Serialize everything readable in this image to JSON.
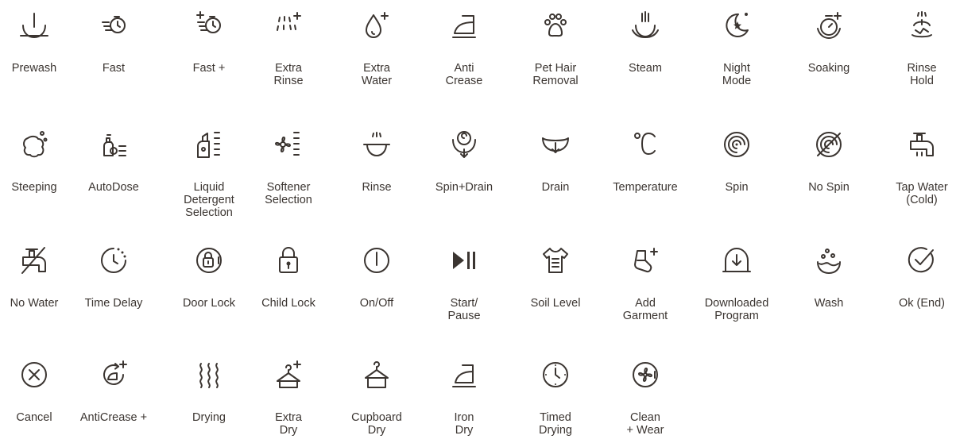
{
  "icons": [
    {
      "label": "Prewash",
      "icon": "prewash-icon"
    },
    {
      "label": "Fast",
      "icon": "fast-icon"
    },
    {
      "label": "Fast +",
      "icon": "fast-plus-icon"
    },
    {
      "label": "Extra\nRinse",
      "icon": "extra-rinse-icon"
    },
    {
      "label": "Extra\nWater",
      "icon": "extra-water-icon"
    },
    {
      "label": "Anti\nCrease",
      "icon": "anti-crease-icon"
    },
    {
      "label": "Pet Hair\nRemoval",
      "icon": "pet-hair-removal-icon"
    },
    {
      "label": "Steam",
      "icon": "steam-icon"
    },
    {
      "label": "Night\nMode",
      "icon": "night-mode-icon"
    },
    {
      "label": "Soaking",
      "icon": "soaking-icon"
    },
    {
      "label": "Rinse\nHold",
      "icon": "rinse-hold-icon"
    },
    {
      "label": "Steeping",
      "icon": "steeping-icon"
    },
    {
      "label": "AutoDose",
      "icon": "autodose-icon"
    },
    {
      "label": "Liquid\nDetergent\nSelection",
      "icon": "liquid-detergent-icon"
    },
    {
      "label": "Softener\nSelection",
      "icon": "softener-icon"
    },
    {
      "label": "Rinse",
      "icon": "rinse-icon"
    },
    {
      "label": "Spin+Drain",
      "icon": "spin-drain-icon"
    },
    {
      "label": "Drain",
      "icon": "drain-icon"
    },
    {
      "label": "Temperature",
      "icon": "temperature-icon"
    },
    {
      "label": "Spin",
      "icon": "spin-icon"
    },
    {
      "label": "No Spin",
      "icon": "no-spin-icon"
    },
    {
      "label": "Tap Water\n(Cold)",
      "icon": "tap-water-icon"
    },
    {
      "label": "No Water",
      "icon": "no-water-icon"
    },
    {
      "label": "Time Delay",
      "icon": "time-delay-icon"
    },
    {
      "label": "Door Lock",
      "icon": "door-lock-icon"
    },
    {
      "label": "Child Lock",
      "icon": "child-lock-icon"
    },
    {
      "label": "On/Off",
      "icon": "on-off-icon"
    },
    {
      "label": "Start/\nPause",
      "icon": "start-pause-icon"
    },
    {
      "label": "Soil Level",
      "icon": "soil-level-icon"
    },
    {
      "label": "Add\nGarment",
      "icon": "add-garment-icon"
    },
    {
      "label": "Downloaded\nProgram",
      "icon": "downloaded-program-icon"
    },
    {
      "label": "Wash",
      "icon": "wash-icon"
    },
    {
      "label": "Ok (End)",
      "icon": "ok-end-icon"
    },
    {
      "label": "Cancel",
      "icon": "cancel-icon"
    },
    {
      "label": "AntiCrease +",
      "icon": "anti-crease-plus-icon"
    },
    {
      "label": "Drying",
      "icon": "drying-icon"
    },
    {
      "label": "Extra\nDry",
      "icon": "extra-dry-icon"
    },
    {
      "label": "Cupboard\nDry",
      "icon": "cupboard-dry-icon"
    },
    {
      "label": "Iron\nDry",
      "icon": "iron-dry-icon"
    },
    {
      "label": "Timed\nDrying",
      "icon": "timed-drying-icon"
    },
    {
      "label": "Clean\n+ Wear",
      "icon": "clean-wear-icon"
    }
  ],
  "colors": {
    "ink": "#3b3531",
    "background": "#ffffff"
  }
}
